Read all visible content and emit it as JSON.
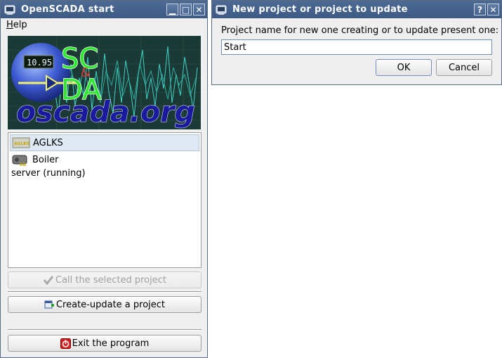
{
  "start_window": {
    "title": "OpenSCADA start",
    "menu": {
      "help_prefix": "H",
      "help_rest": "elp"
    },
    "banner": {
      "display_value": "10.95",
      "sc_text": "SC",
      "amp_text": "&",
      "da_text": "DA",
      "site_text": "oscada.org"
    },
    "projects": [
      {
        "name": "AGLKS",
        "selected": true,
        "badge": "AGLKS"
      },
      {
        "name": "Boiler",
        "selected": false,
        "badge": "KB"
      }
    ],
    "server_status": "server (running)",
    "call_button": "Call the selected project",
    "create_button": "Create-update a project",
    "exit_button": "Exit the program"
  },
  "dialog": {
    "title": "New project or project to update",
    "prompt": "Project name for new one creating or to update present one:",
    "input_value": "Start",
    "ok_button": "OK",
    "cancel_button": "Cancel",
    "help_glyph": "?",
    "close_glyph": "✕"
  },
  "titlebar_glyphs": {
    "minimize": "▁",
    "maximize": "□",
    "close": "✕"
  },
  "colors": {
    "titlebar": "#4d6a93",
    "accent": "#6f8fb8",
    "banner_text_green": "#2ee82e",
    "banner_text_blue": "#1a1a9e"
  }
}
